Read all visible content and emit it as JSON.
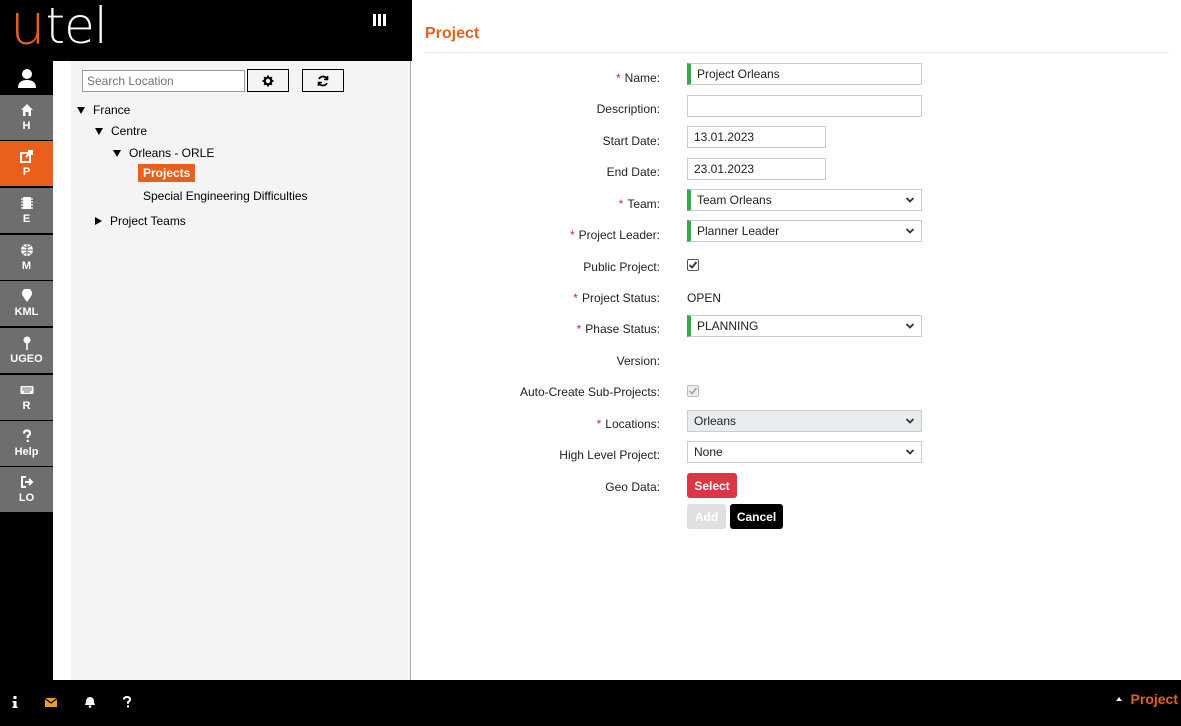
{
  "logo": {
    "u": "u",
    "rest": "tel"
  },
  "nav": [
    {
      "label": "H",
      "icon": "home-icon"
    },
    {
      "label": "P",
      "icon": "share-icon",
      "active": true
    },
    {
      "label": "E",
      "icon": "chip-icon"
    },
    {
      "label": "M",
      "icon": "globe-icon"
    },
    {
      "label": "KML",
      "icon": "map-marker-icon"
    },
    {
      "label": "UGEO",
      "icon": "pin-icon"
    },
    {
      "label": "R",
      "icon": "keyboard-icon"
    },
    {
      "label": "Help",
      "icon": "question-icon"
    },
    {
      "label": "LO",
      "icon": "logout-icon"
    }
  ],
  "tree": {
    "search_placeholder": "Search Location",
    "nodes": {
      "france": "France",
      "centre": "Centre",
      "orleans": "Orleans - ORLE",
      "projects": "Projects",
      "special": "Special Engineering Difficulties",
      "project_teams": "Project Teams"
    }
  },
  "form": {
    "title": "Project",
    "required_mark": "*",
    "labels": {
      "name": "Name:",
      "description": "Description:",
      "start_date": "Start Date:",
      "end_date": "End Date:",
      "team": "Team:",
      "project_leader": "Project Leader:",
      "public_project": "Public Project:",
      "project_status": "Project Status:",
      "phase_status": "Phase Status:",
      "version": "Version:",
      "auto_create": "Auto-Create Sub-Projects:",
      "locations": "Locations:",
      "high_level": "High Level Project:",
      "geo_data": "Geo Data:"
    },
    "values": {
      "name": "Project Orleans",
      "description": "",
      "start_date": "13.01.2023",
      "end_date": "23.01.2023",
      "team": "Team Orleans",
      "project_leader": "Planner Leader",
      "public_project": true,
      "project_status": "OPEN",
      "phase_status": "PLANNING",
      "version": "",
      "auto_create": true,
      "locations": "Orleans",
      "high_level": "None"
    },
    "buttons": {
      "select": "Select",
      "add": "Add",
      "cancel": "Cancel"
    }
  },
  "bottom": {
    "project_label": "Project"
  },
  "colors": {
    "accent": "#e8601c",
    "required": "#d9252b",
    "valid": "#3aa84a",
    "danger": "#dc3545"
  }
}
